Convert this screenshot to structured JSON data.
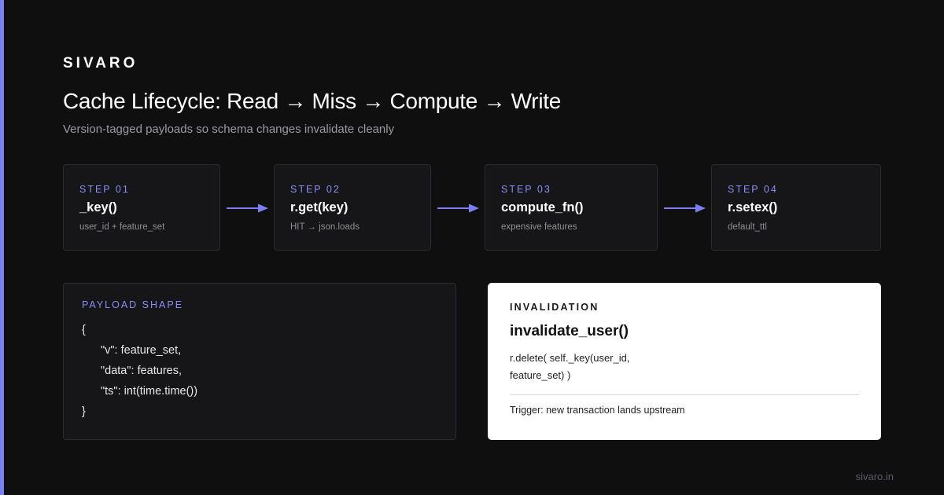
{
  "brand": "SIVARO",
  "title": "Cache Lifecycle: Read → Miss → Compute → Write",
  "subtitle": "Version-tagged payloads so schema changes invalidate cleanly",
  "steps": [
    {
      "label": "STEP 01",
      "title": "_key()",
      "desc": "user_id + feature_set"
    },
    {
      "label": "STEP 02",
      "title": "r.get(key)",
      "desc": "HIT → json.loads"
    },
    {
      "label": "STEP 03",
      "title": "compute_fn()",
      "desc": "expensive features"
    },
    {
      "label": "STEP 04",
      "title": "r.setex()",
      "desc": "default_ttl"
    }
  ],
  "payload": {
    "label": "PAYLOAD SHAPE",
    "lines": [
      "{",
      "\"v\": feature_set,",
      "\"data\": features,",
      "\"ts\": int(time.time())",
      "}"
    ]
  },
  "invalidation": {
    "label": "INVALIDATION",
    "title": "invalidate_user()",
    "code_line1": "r.delete( self._key(user_id,",
    "code_line2": "feature_set) )",
    "trigger": "Trigger: new transaction lands upstream"
  },
  "footer": "sivaro.in",
  "colors": {
    "accent": "#7b7ff4",
    "background": "#0f0f10",
    "card": "#161618",
    "invalidation_card": "#ffffff"
  }
}
